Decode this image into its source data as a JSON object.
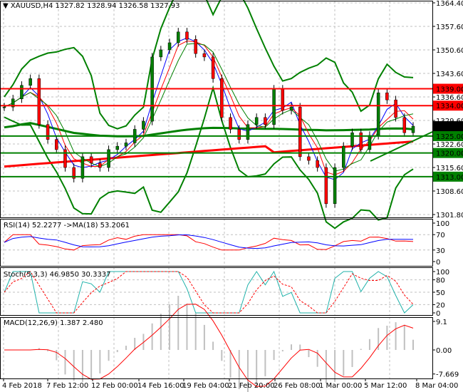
{
  "header": {
    "symbol": "XAUUSD,H4",
    "open": "1327.82",
    "high": "1328.94",
    "low": "1326.58",
    "close": "1327.93"
  },
  "colors": {
    "bull": "#008000",
    "bear": "#ff0000",
    "levelRed": "#ff0000",
    "levelGreen": "#008000",
    "rsi": "#ff0000",
    "rsiMa": "#0000ff",
    "stochMain": "#20b2aa",
    "stochSignal": "#ff0000",
    "macd": "#ff0000",
    "hist": "#c0c0c0"
  },
  "chart_data": [
    {
      "type": "candlestick",
      "title": "XAUUSD,H4",
      "ylim": [
        1301.8,
        1364.4
      ],
      "yticks": [
        "1364.40",
        "1357.60",
        "1350.60",
        "1343.60",
        "1336.60",
        "1329.60",
        "1322.60",
        "1315.60",
        "1308.60",
        "1301.80"
      ],
      "xticks": [
        "4 Feb 2018",
        "7 Feb 12:00",
        "12 Feb 00:00",
        "14 Feb 16:00",
        "19 Feb 04:00",
        "21 Feb 20:00",
        "26 Feb 08:00",
        "1 Mar 00:00",
        "5 Mar 12:00",
        "8 Mar 04:00"
      ],
      "closes": [
        1333.6,
        1336,
        1340,
        1342,
        1328.4,
        1324,
        1321,
        1315.7,
        1312.5,
        1318.9,
        1317,
        1315.7,
        1321,
        1322,
        1323,
        1327,
        1329.4,
        1348.4,
        1350.5,
        1352.6,
        1355.8,
        1353.6,
        1349.4,
        1348.4,
        1342,
        1330.5,
        1327,
        1324,
        1328.4,
        1330.5,
        1328.4,
        1338.9,
        1332.6,
        1333.6,
        1318.9,
        1317.8,
        1315.7,
        1305,
        1315.7,
        1322,
        1326,
        1321,
        1325.2,
        1337.8,
        1335.7,
        1330.5,
        1326,
        1327.93
      ],
      "levels": [
        {
          "value": 1339.0,
          "label": "1339.00",
          "color": "red"
        },
        {
          "value": 1334.0,
          "label": "1334.00",
          "color": "red"
        },
        {
          "value": 1325.0,
          "label": "1325.00",
          "color": "green"
        },
        {
          "value": 1320.0,
          "label": "1320.00",
          "color": "green"
        },
        {
          "value": 1313.0,
          "label": "1313.00",
          "color": "green"
        }
      ],
      "current_price": "1327.93"
    },
    {
      "type": "line",
      "title": "RSI(14) 52.2277  ->MA(18) 53.2061",
      "yticks": [
        "100",
        "70",
        "30",
        "0"
      ],
      "ylim": [
        0,
        100
      ]
    },
    {
      "type": "line",
      "title": "Stoch(5,3,3) 46.9850 30.3337",
      "yticks": [
        "100",
        "80",
        "50",
        "20",
        "0"
      ],
      "ylim": [
        0,
        100
      ]
    },
    {
      "type": "bar",
      "title": "MACD(12,26,9) 1.387 2.480",
      "yticks": [
        "9.1",
        "0.00",
        "-7.669"
      ],
      "ylim": [
        -7.669,
        9.1
      ]
    }
  ]
}
